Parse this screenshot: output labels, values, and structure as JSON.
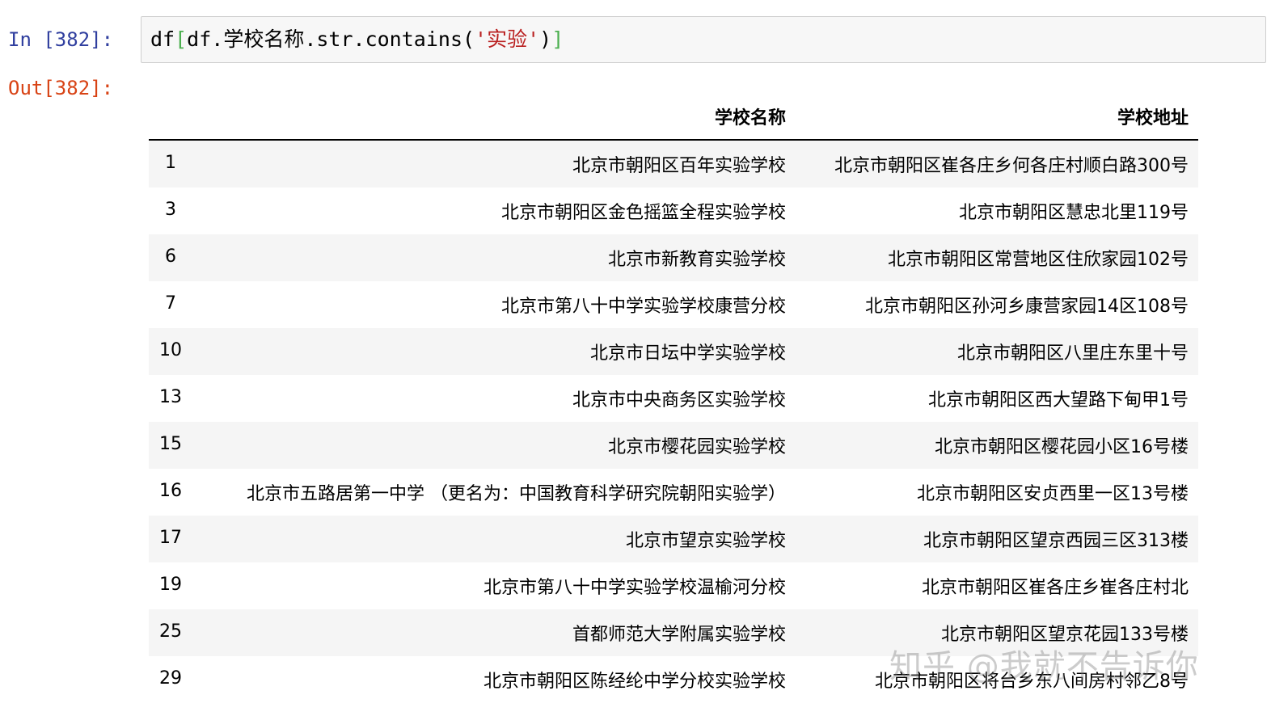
{
  "notebook": {
    "in_prompt": "In [382]:",
    "out_prompt": "Out[382]:",
    "code": {
      "prefix": "df",
      "open_bracket": "[",
      "middle": "df.学校名称.str.contains(",
      "string": "'实验'",
      "close_paren": ")",
      "close_bracket": "]"
    }
  },
  "table": {
    "index_header": "",
    "columns": [
      "学校名称",
      "学校地址"
    ],
    "rows": [
      {
        "index": "1",
        "name": "北京市朝阳区百年实验学校",
        "address": "北京市朝阳区崔各庄乡何各庄村顺白路300号"
      },
      {
        "index": "3",
        "name": "北京市朝阳区金色摇篮全程实验学校",
        "address": "北京市朝阳区慧忠北里119号"
      },
      {
        "index": "6",
        "name": "北京市新教育实验学校",
        "address": "北京市朝阳区常营地区住欣家园102号"
      },
      {
        "index": "7",
        "name": "北京市第八十中学实验学校康营分校",
        "address": "北京市朝阳区孙河乡康营家园14区108号"
      },
      {
        "index": "10",
        "name": "北京市日坛中学实验学校",
        "address": "北京市朝阳区八里庄东里十号"
      },
      {
        "index": "13",
        "name": "北京市中央商务区实验学校",
        "address": "北京市朝阳区西大望路下甸甲1号"
      },
      {
        "index": "15",
        "name": "北京市樱花园实验学校",
        "address": "北京市朝阳区樱花园小区16号楼"
      },
      {
        "index": "16",
        "name": "北京市五路居第一中学 （更名为：中国教育科学研究院朝阳实验学）",
        "address": "北京市朝阳区安贞西里一区13号楼"
      },
      {
        "index": "17",
        "name": "北京市望京实验学校",
        "address": "北京市朝阳区望京西园三区313楼"
      },
      {
        "index": "19",
        "name": "北京市第八十中学实验学校温榆河分校",
        "address": "北京市朝阳区崔各庄乡崔各庄村北"
      },
      {
        "index": "25",
        "name": "首都师范大学附属实验学校",
        "address": "北京市朝阳区望京花园133号楼"
      },
      {
        "index": "29",
        "name": "北京市朝阳区陈经纶中学分校实验学校",
        "address": "北京市朝阳区将台乡东八间房村邻乙8号"
      }
    ]
  },
  "watermark": "知乎 @我就不告诉你"
}
